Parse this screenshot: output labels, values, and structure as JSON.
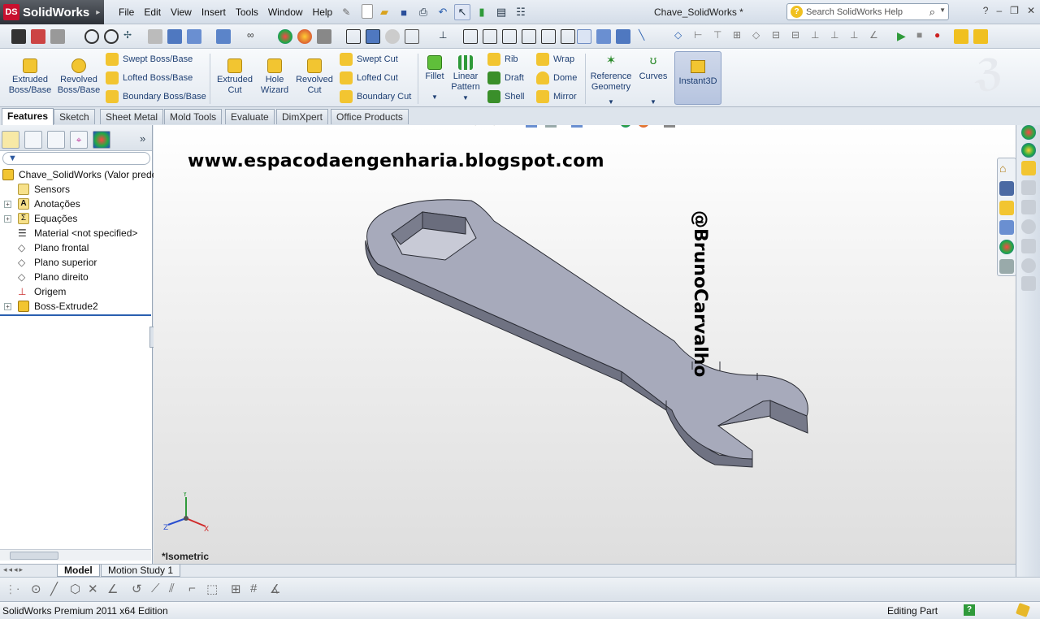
{
  "app": {
    "name": "SolidWorks",
    "logo_mark": "DS",
    "document_title": "Chave_SolidWorks *"
  },
  "menu": [
    "File",
    "Edit",
    "View",
    "Insert",
    "Tools",
    "Window",
    "Help"
  ],
  "search": {
    "placeholder": "Search SolidWorks Help"
  },
  "window_controls": {
    "help": "?",
    "minimize": "–",
    "restore": "❐",
    "close": "✕"
  },
  "ribbon": {
    "extruded_boss": "Extruded Boss/Base",
    "revolved_boss": "Revolved Boss/Base",
    "swept_boss": "Swept Boss/Base",
    "lofted_boss": "Lofted Boss/Base",
    "boundary_boss": "Boundary Boss/Base",
    "extruded_cut": "Extruded Cut",
    "hole_wizard": "Hole Wizard",
    "revolved_cut": "Revolved Cut",
    "swept_cut": "Swept Cut",
    "lofted_cut": "Lofted Cut",
    "boundary_cut": "Boundary Cut",
    "fillet": "Fillet",
    "linear_pattern": "Linear Pattern",
    "rib": "Rib",
    "draft": "Draft",
    "shell": "Shell",
    "wrap": "Wrap",
    "dome": "Dome",
    "mirror": "Mirror",
    "reference_geometry": "Reference Geometry",
    "curves": "Curves",
    "instant3d": "Instant3D"
  },
  "command_tabs": [
    "Features",
    "Sketch",
    "Sheet Metal",
    "Mold Tools",
    "Evaluate",
    "DimXpert",
    "Office Products"
  ],
  "tree": {
    "root": "Chave_SolidWorks  (Valor predeterminado)",
    "items": [
      {
        "label": "Sensors",
        "expandable": false
      },
      {
        "label": "Anotações",
        "expandable": true
      },
      {
        "label": "Equações",
        "expandable": true
      },
      {
        "label": "Material <not specified>",
        "expandable": false
      },
      {
        "label": "Plano frontal",
        "expandable": false
      },
      {
        "label": "Plano superior",
        "expandable": false
      },
      {
        "label": "Plano direito",
        "expandable": false
      },
      {
        "label": "Origem",
        "expandable": false
      },
      {
        "label": "Boss-Extrude2",
        "expandable": true
      }
    ]
  },
  "graphics": {
    "watermark": "www.espacodaengenharia.blogspot.com",
    "signature": "@BrunoCarvalho",
    "view_name": "*Isometric",
    "triad": {
      "x": "X",
      "y": "Y",
      "z": "Z"
    }
  },
  "model_tabs": [
    "Model",
    "Motion Study 1"
  ],
  "status": {
    "edition": "SolidWorks Premium 2011 x64 Edition",
    "mode": "Editing Part",
    "help_badge": "?"
  },
  "colors": {
    "model_face": "#9c9fb0",
    "model_top": "#a6a9bb",
    "model_side": "#7d8090",
    "accent_blue": "#1e3f73",
    "ds_red": "#c8102e"
  }
}
